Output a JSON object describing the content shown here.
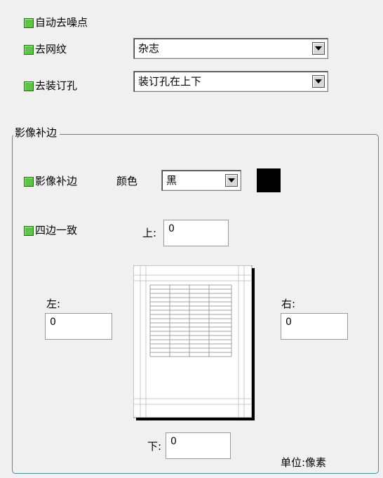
{
  "options": {
    "auto_denoise_label": "自动去噪点",
    "remove_moire_label": "去网纹",
    "remove_moire_value": "杂志",
    "remove_holes_label": "去装订孔",
    "remove_holes_value": "装订孔在上下"
  },
  "border_group": {
    "title": "影像补边",
    "enable_label": "影像补边",
    "color_label": "颜色",
    "color_value": "黑",
    "swatch_color": "#000000",
    "uniform_label": "四边一致",
    "top_label": "上:",
    "top_value": "0",
    "left_label": "左:",
    "left_value": "0",
    "right_label": "右:",
    "right_value": "0",
    "bottom_label": "下:",
    "bottom_value": "0",
    "unit_label": "单位:像素"
  },
  "colors": {
    "checkbox_green": "#5ec447",
    "group_border": "#4a8d9f"
  }
}
